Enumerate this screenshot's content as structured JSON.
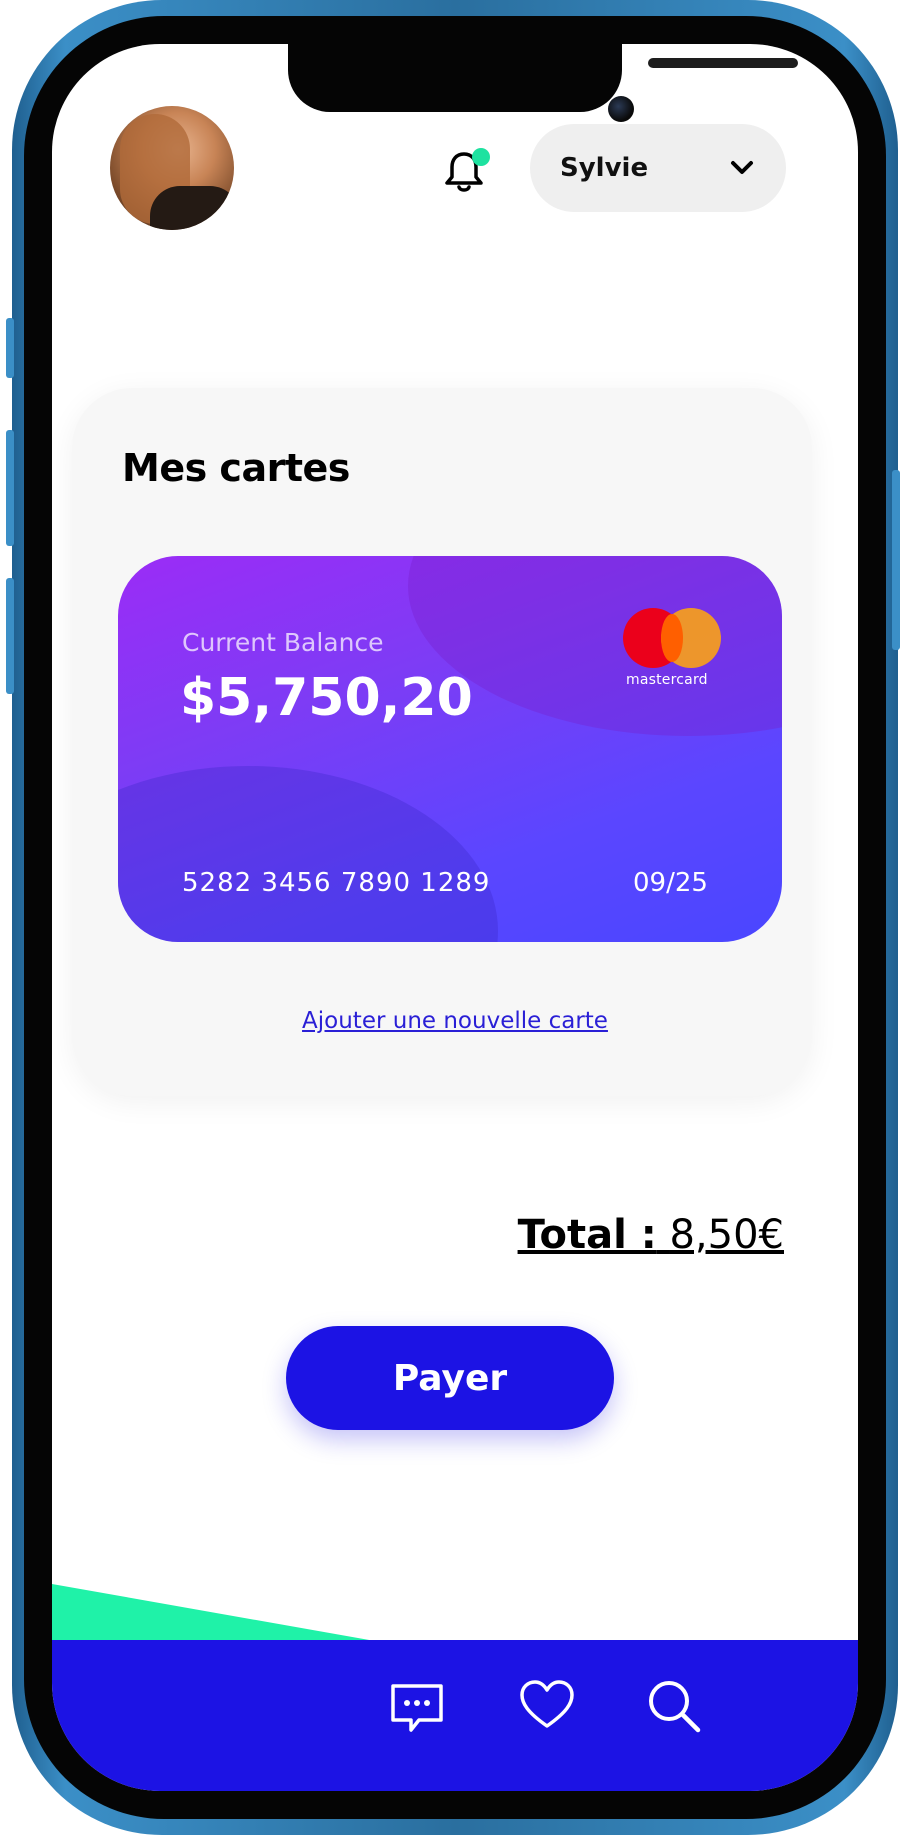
{
  "header": {
    "user_name": "Sylvie"
  },
  "cards_panel": {
    "title": "Mes cartes",
    "card": {
      "balance_label": "Current Balance",
      "balance": "$5,750,20",
      "number": "5282 3456 7890 1289",
      "expiry": "09/25",
      "brand": "mastercard"
    },
    "add_card_link": "Ajouter une nouvelle carte"
  },
  "checkout": {
    "total_label": "Total :",
    "total_value": "8,50€",
    "pay_button": "Payer"
  },
  "tabbar": {
    "icons": [
      "chat-icon",
      "heart-icon",
      "search-icon"
    ]
  },
  "colors": {
    "primary": "#1c13e4",
    "accent": "#1ee2a0",
    "card_gradient_start": "#9b2cf6",
    "card_gradient_end": "#4a46ff",
    "link": "#2a1fd6"
  }
}
